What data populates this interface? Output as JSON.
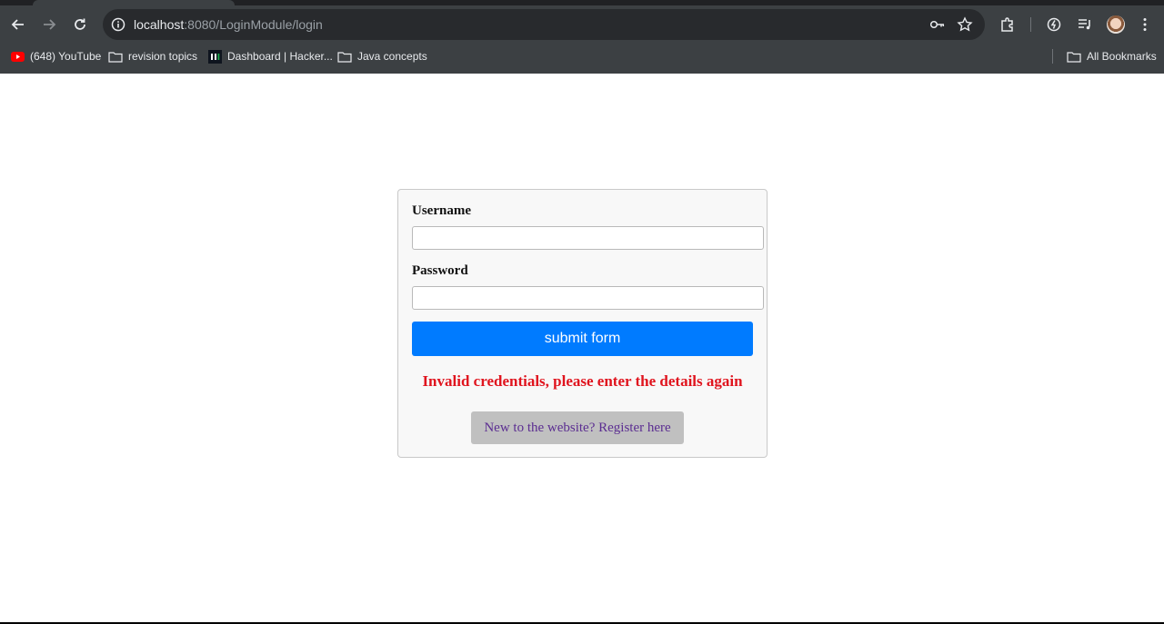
{
  "browser": {
    "url_host": "localhost",
    "url_path": ":8080/LoginModule/login",
    "bookmarks": [
      {
        "label": "(648) YouTube",
        "icon": "youtube-icon"
      },
      {
        "label": "revision topics",
        "icon": "folder-icon"
      },
      {
        "label": "Dashboard | Hacker...",
        "icon": "hackerrank-icon"
      },
      {
        "label": "Java concepts",
        "icon": "folder-icon"
      }
    ],
    "all_bookmarks_label": "All Bookmarks"
  },
  "form": {
    "username_label": "Username",
    "username_value": "",
    "password_label": "Password",
    "password_value": "",
    "submit_label": "submit form",
    "error_message": "Invalid credentials, please enter the details again",
    "register_link": "New to the website? Register here"
  },
  "colors": {
    "chrome_bg": "#3c4043",
    "submit_bg": "#007bff",
    "error_text": "#e0141e",
    "register_bg": "#c0c0c0",
    "register_text": "#5b2d91"
  }
}
